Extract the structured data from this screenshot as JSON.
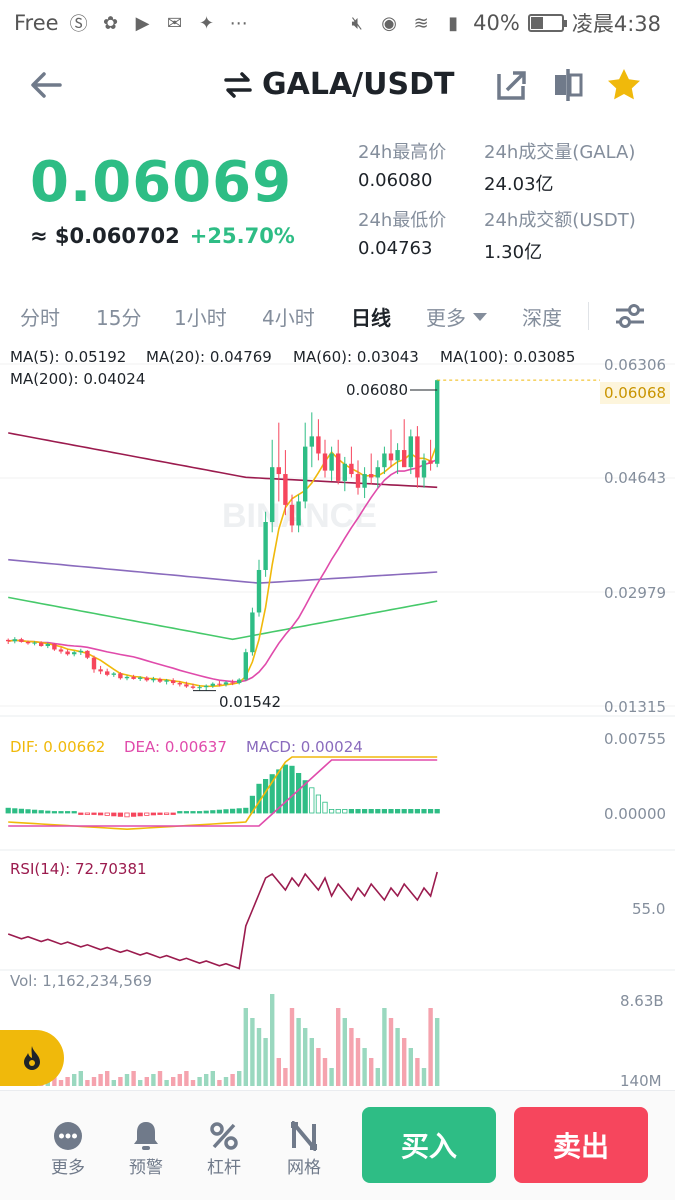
{
  "status": {
    "carrier": "Free",
    "battery": "40%",
    "battery_level": 0.4,
    "time": "凌晨4:38"
  },
  "header": {
    "pair": "GALA/USDT"
  },
  "ticker": {
    "last_price": "0.06069",
    "usd_price": "≈ $0.060702",
    "change": "+25.70%",
    "high_label": "24h最高价",
    "high_value": "0.06080",
    "low_label": "24h最低价",
    "low_value": "0.04763",
    "vol_label": "24h成交量(GALA)",
    "vol_value": "24.03亿",
    "amount_label": "24h成交额(USDT)",
    "amount_value": "1.30亿"
  },
  "tabs": [
    "分时",
    "15分",
    "1小时",
    "4小时",
    "日线",
    "更多",
    "深度"
  ],
  "active_tab": "日线",
  "colors": {
    "up": "#2ebd85",
    "down": "#f6465d",
    "ma5": "#f0b90b",
    "ma20": "#e04bab",
    "ma60": "#46c96a",
    "ma100": "#8a6bbd",
    "ma200": "#9b1b4e",
    "accent": "#f0b90b"
  },
  "chart_data": {
    "type": "candlestick",
    "ma_legend": {
      "ma5": "MA(5): 0.05192",
      "ma20": "MA(20): 0.04769",
      "ma60": "MA(60): 0.03043",
      "ma100": "MA(100): 0.03085",
      "ma200": "MA(200): 0.04024"
    },
    "price_axis": [
      "0.06306",
      "0.04643",
      "0.02979",
      "0.01315"
    ],
    "current_price_tag": "0.06068",
    "high_marker": "0.06080",
    "low_marker": "0.01542",
    "ylim": [
      0.01315,
      0.06306
    ],
    "macd_legend": {
      "dif": "DIF: 0.00662",
      "dea": "DEA: 0.00637",
      "macd": "MACD: 0.00024"
    },
    "macd_axis": [
      "0.00755",
      "0.00000"
    ],
    "rsi_legend": "RSI(14): 72.70381",
    "rsi_axis": "55.0",
    "vol_legend": "Vol: 1,162,234,569",
    "vol_axis": [
      "8.63B",
      "140M"
    ],
    "candles": [
      [
        0.0228,
        0.023,
        0.0222,
        0.0226
      ],
      [
        0.0226,
        0.0232,
        0.0223,
        0.0229
      ],
      [
        0.0229,
        0.0231,
        0.0224,
        0.0225
      ],
      [
        0.0225,
        0.0227,
        0.0221,
        0.0223
      ],
      [
        0.0223,
        0.0226,
        0.022,
        0.0224
      ],
      [
        0.0224,
        0.0226,
        0.0218,
        0.0219
      ],
      [
        0.0219,
        0.0224,
        0.0216,
        0.0222
      ],
      [
        0.0222,
        0.0223,
        0.0212,
        0.0214
      ],
      [
        0.0214,
        0.0217,
        0.0208,
        0.0211
      ],
      [
        0.0211,
        0.0214,
        0.0205,
        0.0207
      ],
      [
        0.0207,
        0.0212,
        0.0204,
        0.021
      ],
      [
        0.021,
        0.0215,
        0.0206,
        0.0212
      ],
      [
        0.0212,
        0.0213,
        0.02,
        0.0202
      ],
      [
        0.0202,
        0.0205,
        0.018,
        0.0185
      ],
      [
        0.0185,
        0.019,
        0.0178,
        0.0182
      ],
      [
        0.0182,
        0.0186,
        0.0175,
        0.0177
      ],
      [
        0.0177,
        0.0181,
        0.0174,
        0.0179
      ],
      [
        0.0179,
        0.0181,
        0.017,
        0.0172
      ],
      [
        0.0172,
        0.0176,
        0.0169,
        0.0174
      ],
      [
        0.0174,
        0.0177,
        0.017,
        0.0171
      ],
      [
        0.0171,
        0.0175,
        0.0168,
        0.0173
      ],
      [
        0.0173,
        0.0175,
        0.0167,
        0.0169
      ],
      [
        0.0169,
        0.0174,
        0.0166,
        0.0171
      ],
      [
        0.0171,
        0.0173,
        0.0165,
        0.0167
      ],
      [
        0.0167,
        0.0171,
        0.0163,
        0.0169
      ],
      [
        0.0169,
        0.0172,
        0.0162,
        0.0165
      ],
      [
        0.0165,
        0.0168,
        0.016,
        0.0163
      ],
      [
        0.0163,
        0.0167,
        0.0158,
        0.016
      ],
      [
        0.016,
        0.0164,
        0.0156,
        0.0158
      ],
      [
        0.0158,
        0.0162,
        0.0154,
        0.0159
      ],
      [
        0.0159,
        0.0163,
        0.0154,
        0.0161
      ],
      [
        0.0161,
        0.0166,
        0.0158,
        0.0164
      ],
      [
        0.0164,
        0.0168,
        0.016,
        0.0163
      ],
      [
        0.0163,
        0.0168,
        0.016,
        0.0166
      ],
      [
        0.0166,
        0.017,
        0.0162,
        0.0165
      ],
      [
        0.0165,
        0.0172,
        0.0163,
        0.017
      ],
      [
        0.017,
        0.0215,
        0.0168,
        0.021
      ],
      [
        0.021,
        0.0275,
        0.0205,
        0.0268
      ],
      [
        0.0268,
        0.0345,
        0.0262,
        0.033
      ],
      [
        0.033,
        0.0415,
        0.032,
        0.04
      ],
      [
        0.04,
        0.052,
        0.0385,
        0.048
      ],
      [
        0.048,
        0.0545,
        0.043,
        0.047
      ],
      [
        0.047,
        0.0505,
        0.041,
        0.0425
      ],
      [
        0.0425,
        0.044,
        0.0385,
        0.0395
      ],
      [
        0.0395,
        0.044,
        0.0385,
        0.043
      ],
      [
        0.043,
        0.0545,
        0.042,
        0.051
      ],
      [
        0.051,
        0.056,
        0.048,
        0.0525
      ],
      [
        0.0525,
        0.055,
        0.049,
        0.05
      ],
      [
        0.05,
        0.052,
        0.0465,
        0.0475
      ],
      [
        0.0475,
        0.051,
        0.046,
        0.05
      ],
      [
        0.05,
        0.052,
        0.0455,
        0.046
      ],
      [
        0.046,
        0.0495,
        0.0445,
        0.0485
      ],
      [
        0.0485,
        0.051,
        0.0465,
        0.047
      ],
      [
        0.047,
        0.049,
        0.044,
        0.045
      ],
      [
        0.045,
        0.048,
        0.0435,
        0.047
      ],
      [
        0.047,
        0.05,
        0.0455,
        0.0465
      ],
      [
        0.0465,
        0.049,
        0.045,
        0.048
      ],
      [
        0.048,
        0.051,
        0.047,
        0.05
      ],
      [
        0.05,
        0.0535,
        0.048,
        0.049
      ],
      [
        0.049,
        0.0515,
        0.047,
        0.0505
      ],
      [
        0.0505,
        0.055,
        0.0495,
        0.048
      ],
      [
        0.048,
        0.0535,
        0.047,
        0.0525
      ],
      [
        0.0525,
        0.054,
        0.045,
        0.0465
      ],
      [
        0.0465,
        0.05,
        0.045,
        0.049
      ],
      [
        0.049,
        0.052,
        0.0475,
        0.0485
      ],
      [
        0.0485,
        0.0608,
        0.048,
        0.0607
      ]
    ]
  },
  "bottom": {
    "more": "更多",
    "alert": "预警",
    "leverage": "杠杆",
    "grid": "网格",
    "buy": "买入",
    "sell": "卖出"
  },
  "watermark": "BINANCE"
}
